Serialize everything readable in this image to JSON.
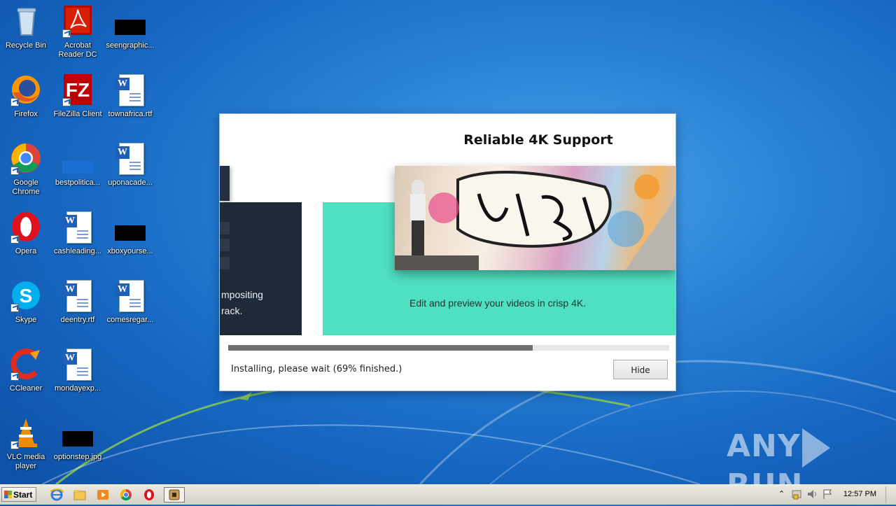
{
  "desktop": {
    "icons": [
      {
        "label": "Recycle Bin"
      },
      {
        "label": "Acrobat Reader DC"
      },
      {
        "label": "seengraphic..."
      },
      {
        "label": "Firefox"
      },
      {
        "label": "FileZilla Client"
      },
      {
        "label": "townafrica.rtf"
      },
      {
        "label": "Google Chrome"
      },
      {
        "label": "bestpolitica..."
      },
      {
        "label": "uponacade..."
      },
      {
        "label": "Opera"
      },
      {
        "label": "cashleading..."
      },
      {
        "label": "xboxyourse..."
      },
      {
        "label": "Skype"
      },
      {
        "label": "deentry.rtf"
      },
      {
        "label": "comesregar..."
      },
      {
        "label": "CCleaner"
      },
      {
        "label": "mondayexp..."
      },
      {
        "label": "VLC media player"
      },
      {
        "label": "optionstep.jpg"
      }
    ]
  },
  "installer": {
    "slide_title": "Reliable 4K Support",
    "prev_slide_line1": "mpositing",
    "prev_slide_line2": "rack.",
    "slide_caption": "Edit and preview your videos in crisp 4K.",
    "progress_percent": 69,
    "status_text": "Installing, please wait (69% finished.)",
    "hide_button_label": "Hide"
  },
  "watermark": {
    "left": "ANY",
    "right": "RUN"
  },
  "taskbar": {
    "start_label": "Start",
    "clock": "12:57 PM"
  }
}
